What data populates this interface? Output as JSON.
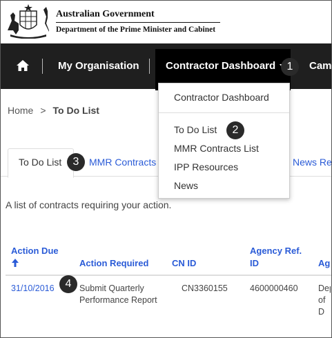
{
  "header": {
    "title": "Australian Government",
    "department": "Department of the Prime Minister and Cabinet"
  },
  "nav": {
    "my_organisation": "My Organisation",
    "contractor_dashboard": "Contractor Dashboard",
    "overflow": "Came"
  },
  "dropdown": {
    "items": [
      "Contractor Dashboard",
      "To Do List",
      "MMR Contracts List",
      "IPP Resources",
      "News"
    ]
  },
  "breadcrumb": {
    "home": "Home",
    "separator": ">",
    "current": "To Do List"
  },
  "tabs": {
    "items": [
      "To Do List",
      "MMR Contracts",
      "News Re"
    ]
  },
  "intro": "A list of contracts requiring your action.",
  "table": {
    "headers": {
      "action_due": "Action Due",
      "action_required": "Action Required",
      "cn_id": "CN ID",
      "agency_ref": "Agency Ref. ID",
      "agency": "Ag"
    },
    "rows": [
      {
        "action_due": "31/10/2016",
        "action_required": "Submit Quarterly Performance Report",
        "cn_id": "CN3360155",
        "agency_ref": "4600000460",
        "agency": "Dep of D"
      }
    ]
  },
  "callouts": [
    "1",
    "2",
    "3",
    "4"
  ],
  "colors": {
    "nav_bg": "#1f1f1f",
    "nav_active_bg": "#000000",
    "link": "#2a5bd7",
    "callout_bg": "#2a2a2a"
  },
  "icons": {
    "home": "home-icon",
    "caret": "caret-down-icon",
    "sort": "sort-up-arrow-icon",
    "crest": "coat-of-arms-logo"
  }
}
